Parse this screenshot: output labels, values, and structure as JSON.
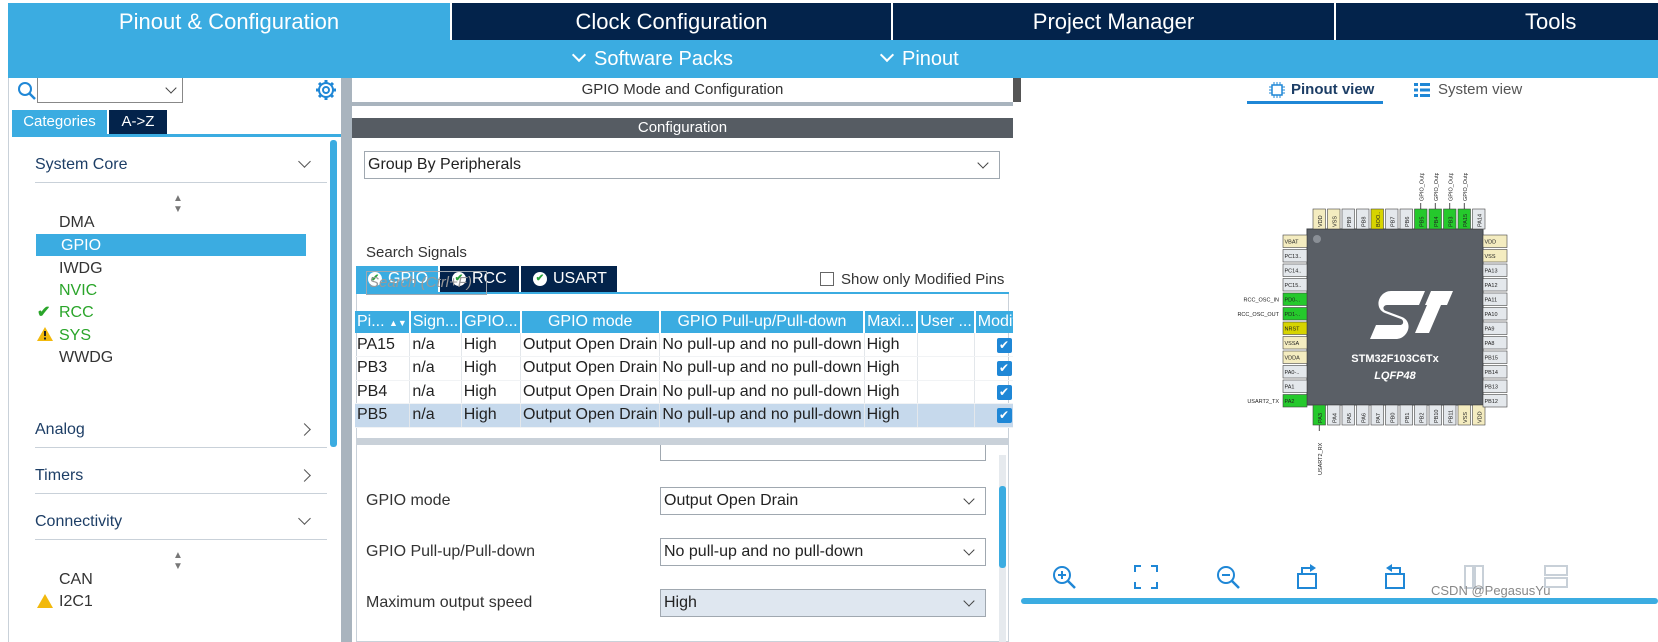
{
  "top_tabs": [
    {
      "label": "Pinout & Configuration",
      "active": true
    },
    {
      "label": "Clock Configuration",
      "active": false
    },
    {
      "label": "Project Manager",
      "active": false
    },
    {
      "label": "Tools",
      "active": false
    }
  ],
  "subbar": {
    "software_packs": "Software Packs",
    "pinout": "Pinout"
  },
  "left": {
    "search_value": "",
    "tab_categories": "Categories",
    "tab_az": "A->Z",
    "system_core": "System Core",
    "core_items": [
      {
        "label": "DMA",
        "status": "none"
      },
      {
        "label": "GPIO",
        "status": "selected"
      },
      {
        "label": "IWDG",
        "status": "none"
      },
      {
        "label": "NVIC",
        "status": "green"
      },
      {
        "label": "RCC",
        "status": "check"
      },
      {
        "label": "SYS",
        "status": "warning"
      },
      {
        "label": "WWDG",
        "status": "none"
      }
    ],
    "analog": "Analog",
    "timers": "Timers",
    "connectivity": "Connectivity",
    "conn_items": [
      "CAN",
      "I2C1"
    ]
  },
  "mid": {
    "header": "GPIO Mode and Configuration",
    "config_title": "Configuration",
    "group_by": "Group By Peripherals",
    "tabs": [
      "GPIO",
      "RCC",
      "USART"
    ],
    "search_label": "Search Signals",
    "search_placeholder": "Search (Ctrl+F)",
    "show_modified": "Show only Modified Pins",
    "columns": [
      "Pi...",
      "Sign...",
      "GPIO...",
      "GPIO mode",
      "GPIO Pull-up/Pull-down",
      "Maxi...",
      "User ...",
      "Modif..."
    ],
    "rows": [
      {
        "pin": "PA15",
        "signal": "n/a",
        "gpio": "High",
        "mode": "Output Open Drain",
        "pull": "No pull-up and no pull-down",
        "max": "High",
        "user": "",
        "modified": true
      },
      {
        "pin": "PB3",
        "signal": "n/a",
        "gpio": "High",
        "mode": "Output Open Drain",
        "pull": "No pull-up and no pull-down",
        "max": "High",
        "user": "",
        "modified": true
      },
      {
        "pin": "PB4",
        "signal": "n/a",
        "gpio": "High",
        "mode": "Output Open Drain",
        "pull": "No pull-up and no pull-down",
        "max": "High",
        "user": "",
        "modified": true
      },
      {
        "pin": "PB5",
        "signal": "n/a",
        "gpio": "High",
        "mode": "Output Open Drain",
        "pull": "No pull-up and no pull-down",
        "max": "High",
        "user": "",
        "modified": true
      }
    ],
    "fields": [
      {
        "label": "GPIO mode",
        "value": "Output Open Drain"
      },
      {
        "label": "GPIO Pull-up/Pull-down",
        "value": "No pull-up and no pull-down"
      },
      {
        "label": "Maximum output speed",
        "value": "High"
      }
    ]
  },
  "right": {
    "pinout_view": "Pinout view",
    "system_view": "System view",
    "chip_name": "STM32F103C6Tx",
    "chip_package": "LQFP48",
    "top_pins": [
      "VDD",
      "VSS",
      "PB9",
      "PB8",
      "BOO..",
      "PB7",
      "PB6",
      "PB5",
      "PB4",
      "PB3",
      "PA15",
      "PA14"
    ],
    "left_pins": [
      "VBAT",
      "PC13..",
      "PC14..",
      "PC15..",
      "PD0-..",
      "PD1-..",
      "NRST",
      "VSSA",
      "VDDA",
      "PA0-..",
      "PA1",
      "PA2"
    ],
    "right_pins": [
      "VDD",
      "VSS",
      "PA13",
      "PA12",
      "PA11",
      "PA10",
      "PA9",
      "PA8",
      "PB15",
      "PB14",
      "PB13",
      "PB12"
    ],
    "bottom_pins": [
      "PA3",
      "PA4",
      "PA5",
      "PA6",
      "PA7",
      "PB0",
      "PB1",
      "PB2",
      "PB10",
      "PB11",
      "VSS",
      "VDD"
    ],
    "top_labels": [
      "GPIO_Output",
      "GPIO_Output",
      "GPIO_Output",
      "GPIO_Output"
    ],
    "left_labels": [
      "RCC_OSC_IN",
      "RCC_OSC_OUT",
      "USART2_TX"
    ],
    "bottom_label": "USART2_RX",
    "watermark": "CSDN @PegasusYu"
  },
  "colors": {
    "accent": "#3bace1",
    "navy": "#03234b",
    "pin_green": "#25c92c",
    "pin_yellow": "#d7d400",
    "pin_beige": "#f4ecc0"
  }
}
